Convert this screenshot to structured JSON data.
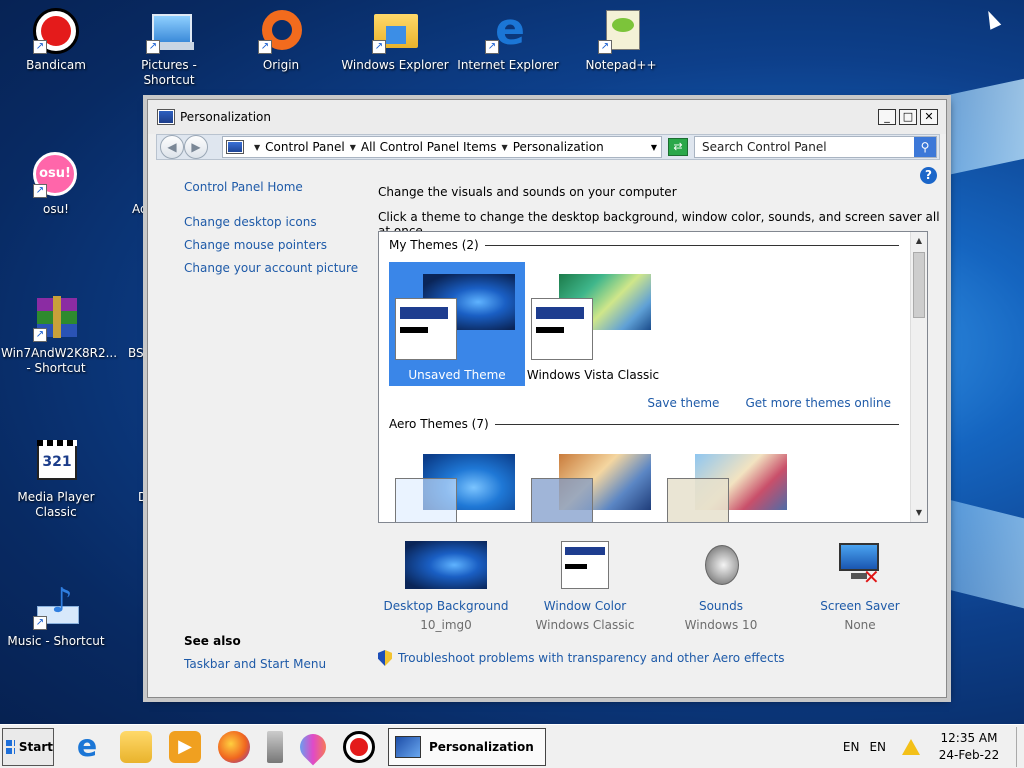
{
  "desktop": {
    "icons": [
      {
        "label": "Bandicam"
      },
      {
        "label": "Pictures - Shortcut"
      },
      {
        "label": "Origin"
      },
      {
        "label": "Windows Explorer"
      },
      {
        "label": "Internet Explorer"
      },
      {
        "label": "Notepad++"
      },
      {
        "label": "osu!",
        "badge": "osu!"
      },
      {
        "label": "Ado"
      },
      {
        "label": "Win7AndW2K8R2... - Shortcut"
      },
      {
        "label": "BSS"
      },
      {
        "label": "Media Player Classic",
        "badge": "321"
      },
      {
        "label": "D"
      },
      {
        "label": "Music - Shortcut"
      }
    ]
  },
  "window": {
    "title": "Personalization",
    "address": {
      "segments": [
        "Control Panel",
        "All Control Panel Items",
        "Personalization"
      ]
    },
    "search_placeholder": "Search Control Panel",
    "left_links": [
      "Control Panel Home",
      "Change desktop icons",
      "Change mouse pointers",
      "Change your account picture"
    ],
    "see_also": {
      "heading": "See also",
      "link": "Taskbar and Start Menu"
    },
    "heading": "Change the visuals and sounds on your computer",
    "subheading": "Click a theme to change the desktop background, window color, sounds, and screen saver all at once.",
    "my_themes": {
      "label": "My Themes (2)",
      "items": [
        {
          "name": "Unsaved Theme",
          "selected": true
        },
        {
          "name": "Windows Vista Classic",
          "selected": false
        }
      ]
    },
    "actions": {
      "save": "Save theme",
      "more": "Get more themes online"
    },
    "aero_themes": {
      "label": "Aero Themes (7)"
    },
    "bottom": [
      {
        "title": "Desktop Background",
        "value": "10_img0"
      },
      {
        "title": "Window Color",
        "value": "Windows Classic"
      },
      {
        "title": "Sounds",
        "value": "Windows 10"
      },
      {
        "title": "Screen Saver",
        "value": "None"
      }
    ],
    "troubleshoot": "Troubleshoot problems with transparency and other Aero effects"
  },
  "taskbar": {
    "start_label": "Start",
    "active_task": "Personalization",
    "lang1": "EN",
    "lang2": "EN",
    "time": "12:35 AM",
    "date": "24-Feb-22"
  },
  "colors": {
    "link": "#1e5aa8",
    "selection": "#3a86e8"
  }
}
